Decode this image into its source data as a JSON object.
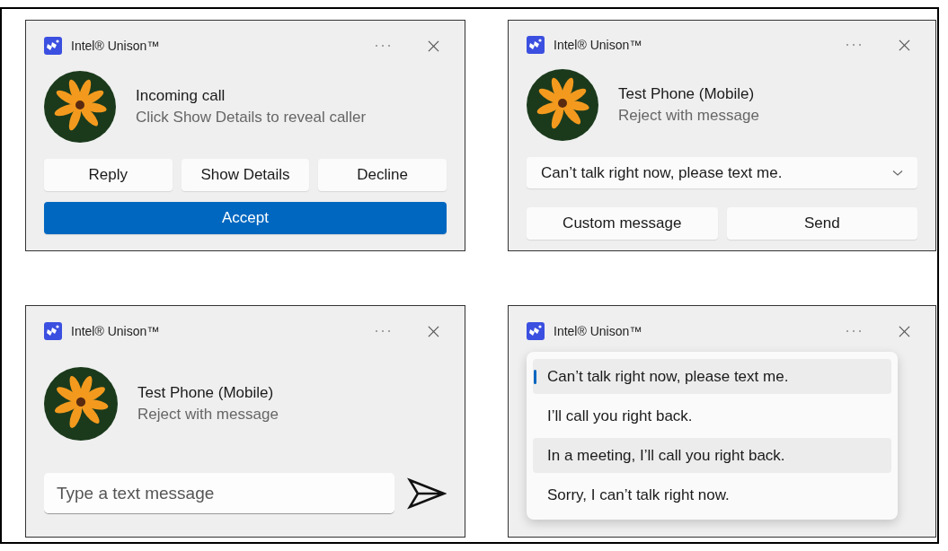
{
  "panels": [
    {
      "kind": "incoming",
      "app_title": "Intel® Unison™",
      "contact": {
        "name": "Incoming call",
        "subtitle": "Click Show Details to reveal caller"
      },
      "buttons": [
        {
          "label": "Reply",
          "primary": false
        },
        {
          "label": "Show Details",
          "primary": false
        },
        {
          "label": "Decline",
          "primary": false
        },
        {
          "label": "Accept",
          "primary": true
        }
      ]
    },
    {
      "kind": "reject",
      "app_title": "Intel® Unison™",
      "contact": {
        "name": "Test Phone (Mobile)",
        "subtitle": "Reject with message"
      },
      "dropdown": {
        "value": "Can’t talk right now, please text me."
      },
      "buttons": [
        {
          "label": "Custom message",
          "primary": false
        },
        {
          "label": "Send",
          "primary": false
        }
      ]
    },
    {
      "kind": "custom",
      "app_title": "Intel® Unison™",
      "contact": {
        "name": "Test Phone (Mobile)",
        "subtitle": "Reject with message"
      },
      "message_field": {
        "placeholder": "Type a text message"
      }
    },
    {
      "kind": "menu",
      "app_title": "Intel® Unison™",
      "menu": [
        {
          "label": "Can’t talk right now, please text me.",
          "selected": true,
          "hovered": false
        },
        {
          "label": "I’ll call you right back.",
          "selected": false,
          "hovered": false
        },
        {
          "label": "In a meeting, I’ll call you right back.",
          "selected": false,
          "hovered": true
        },
        {
          "label": "Sorry, I can’t talk right now.",
          "selected": false,
          "hovered": false
        }
      ]
    }
  ]
}
